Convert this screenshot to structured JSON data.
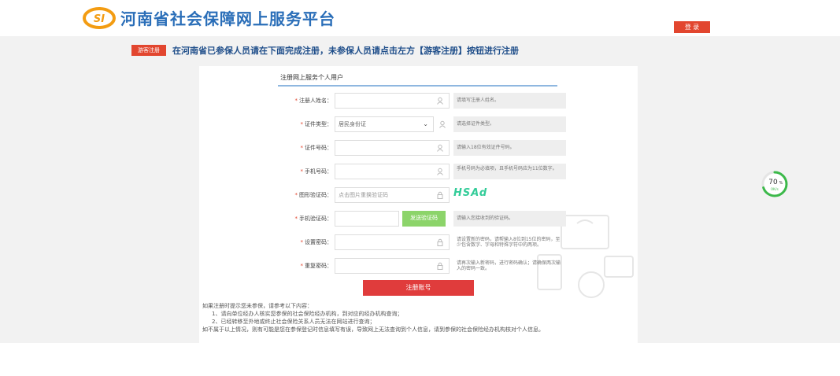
{
  "header": {
    "logo_initials": "SI",
    "site_title": "河南省社会保障网上服务平台",
    "login_label": "登 录"
  },
  "notice": {
    "tag_label": "游客注册",
    "text": "在河南省已参保人员请在下面完成注册，未参保人员请点击左方【游客注册】按钮进行注册"
  },
  "form": {
    "title": "注册网上服务个人用户",
    "rows": [
      {
        "label": "注册人姓名：",
        "value": "",
        "hint": "请填写注册人姓名。"
      },
      {
        "label": "证件类型：",
        "value": "居民身份证",
        "hint": "请选择证件类型。"
      },
      {
        "label": "证件号码：",
        "value": "",
        "hint": "请输入18位有效证件号码。"
      },
      {
        "label": "手机号码：",
        "value": "",
        "hint": "手机号码为必填项，且手机号码应为11位数字。"
      },
      {
        "label": "图形验证码：",
        "placeholder": "点击图片重换验证码",
        "captcha": "HSAd"
      },
      {
        "label": "手机验证码：",
        "button": "发送验证码",
        "hint": "请输入您接收到的验证码。"
      },
      {
        "label": "设置密码：",
        "value": "",
        "hint": "请设置新的密码，请帮输入8位到15位的密码，至少包含数字、字母和特殊字符中的两项。"
      },
      {
        "label": "重复密码：",
        "value": "",
        "hint": "请再次输入新密码，进行密码确认；请确保两次输入的密码一致。"
      }
    ],
    "submit_label": "注册账号"
  },
  "notes": {
    "line1": "如果注册时提示您未参保，请参考以下内容：",
    "line2": "1、请向单位经办人核实您参保的社会保险经办机构，到对应的经办机构查询；",
    "line3": "2、已经转移至外地或终止社会保险关系人员无法在网站进行查询；",
    "line4": "如不属于以上情况，则有可能是您在参保登记时信息填写有误，导致网上无法查询到个人信息，请到参保的社会保险经办机构核对个人信息。"
  },
  "widget": {
    "percent": "70",
    "percent_unit": "%",
    "speed": "0K/s",
    "percent_value": 0.7
  },
  "colors": {
    "accent_red": "#e2462f",
    "title_blue": "#2a6eb8",
    "sms_green": "#8cd46a",
    "progress_green": "#3cb94a"
  }
}
